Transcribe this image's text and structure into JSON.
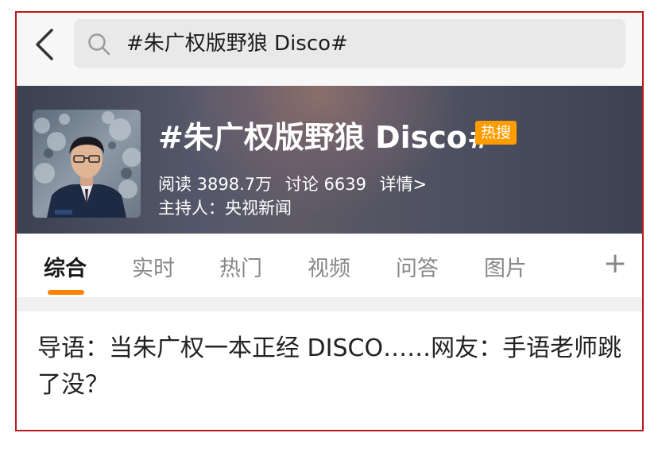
{
  "search": {
    "query": "#朱广权版野狼 Disco#",
    "back_icon": "chevron-left-icon",
    "search_icon": "magnifier-icon"
  },
  "topic": {
    "title": "#朱广权版野狼 Disco#",
    "hot_badge": "热搜",
    "reads": "阅读 3898.7万",
    "discussions": "讨论 6639",
    "details": "详情>",
    "host": "主持人：央视新闻"
  },
  "tabs": [
    {
      "label": "综合",
      "active": true
    },
    {
      "label": "实时",
      "active": false
    },
    {
      "label": "热门",
      "active": false
    },
    {
      "label": "视频",
      "active": false
    },
    {
      "label": "问答",
      "active": false
    },
    {
      "label": "图片",
      "active": false
    }
  ],
  "tabs_more": "+",
  "intro": "导语：当朱广权一本正经 DISCO……网友：手语老师跳了没？",
  "colors": {
    "frame": "#b8191e",
    "accent": "#ff8200",
    "hot_badge": "#ff9c00"
  }
}
